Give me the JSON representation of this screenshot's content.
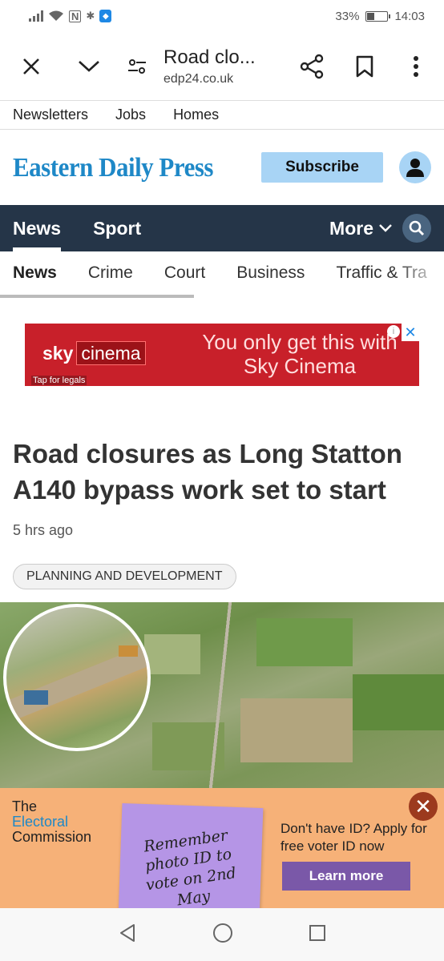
{
  "status": {
    "battery": "33%",
    "time": "14:03"
  },
  "browser": {
    "title": "Road clo...",
    "url": "edp24.co.uk"
  },
  "top_links": [
    "Newsletters",
    "Jobs",
    "Homes"
  ],
  "masthead": {
    "logo": "Eastern Daily Press",
    "subscribe": "Subscribe"
  },
  "main_nav": {
    "items": [
      "News",
      "Sport"
    ],
    "more": "More"
  },
  "sub_nav": [
    "News",
    "Crime",
    "Court",
    "Business",
    "Traffic & Tra"
  ],
  "ad": {
    "brand": "sky",
    "product": "cinema",
    "promo": "You only get this with Sky Cinema",
    "legal": "Tap for legals"
  },
  "article": {
    "headline": "Road closures as Long Statton A140 bypass work set to start",
    "time": "5 hrs ago",
    "tag": "PLANNING AND DEVELOPMENT"
  },
  "banner": {
    "org_line1": "The",
    "org_line2": "Electoral",
    "org_line3": "Commission",
    "note": "Remember photo ID to vote on 2nd May",
    "text": "Don't have ID? Apply for free voter ID now",
    "cta": "Learn more"
  }
}
